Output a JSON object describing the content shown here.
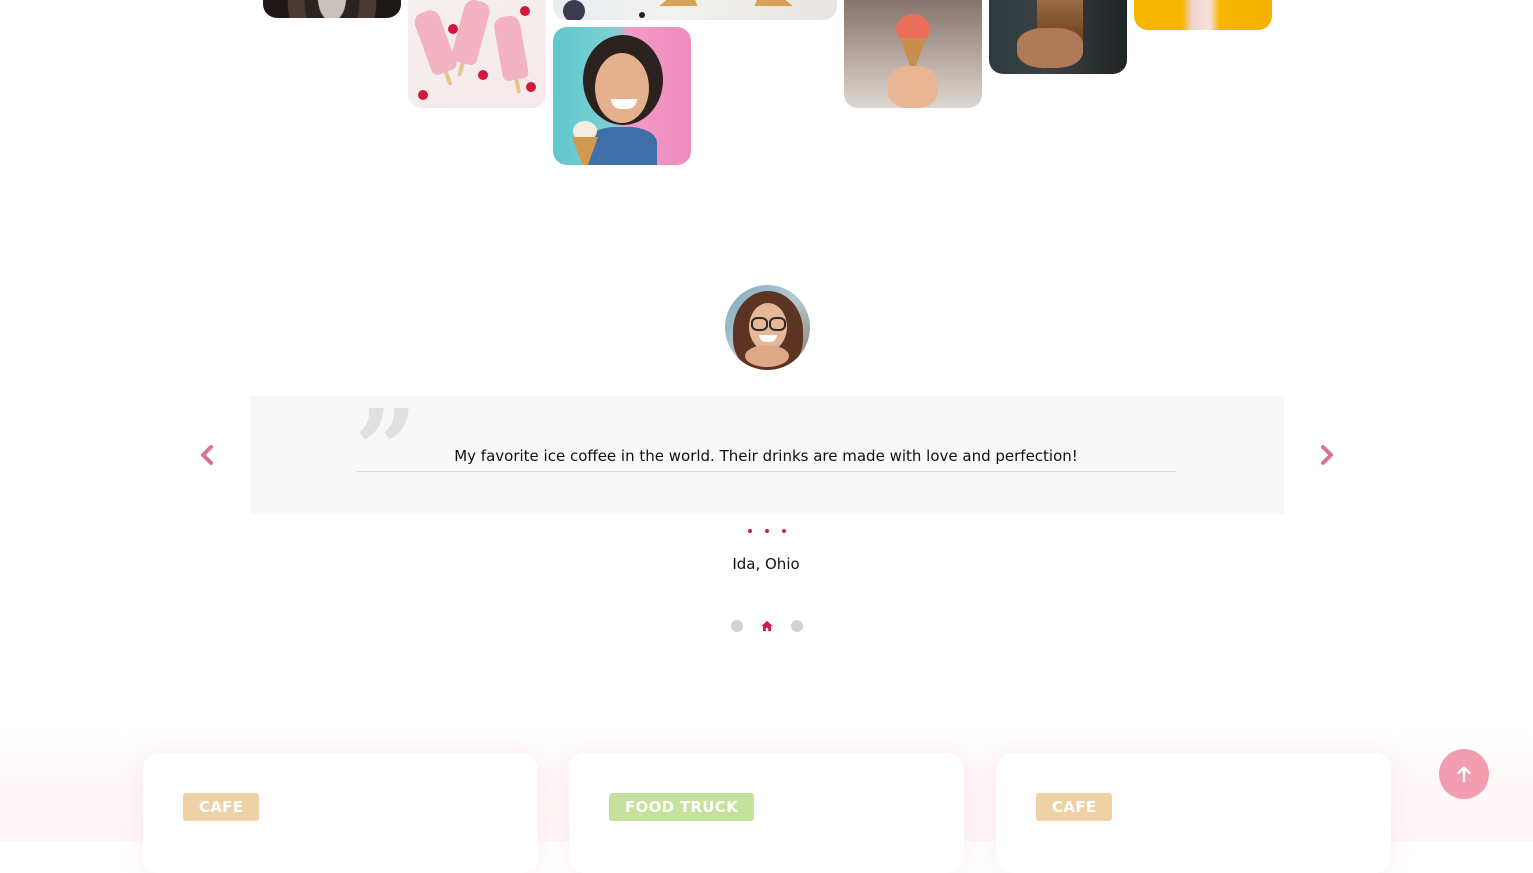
{
  "gallery": {
    "tiles": [
      {
        "name": "dessert-plate"
      },
      {
        "name": "strawberry-popsicles"
      },
      {
        "name": "ice-cream-cones-flatlay"
      },
      {
        "name": "smiling-woman-with-cone"
      },
      {
        "name": "street-ice-cream-cone"
      },
      {
        "name": "iced-coffee-cup"
      },
      {
        "name": "milkshake-bottle"
      }
    ]
  },
  "testimonial": {
    "quote": "My favorite ice coffee in the world. Their drinks are made with love and perfection!",
    "author": "Ida, Ohio",
    "current_slide": 2,
    "total_slides": 3,
    "accent_color": "#d1194a",
    "arrow_color": "#d7738f"
  },
  "cards": [
    {
      "tag": "CAFE",
      "tag_color": "#eed2a6"
    },
    {
      "tag": "FOOD TRUCK",
      "tag_color": "#c5e19b"
    },
    {
      "tag": "CAFE",
      "tag_color": "#eed2a6"
    }
  ],
  "scroll_top": {
    "icon": "arrow-up-icon",
    "color": "#f49cb0"
  }
}
